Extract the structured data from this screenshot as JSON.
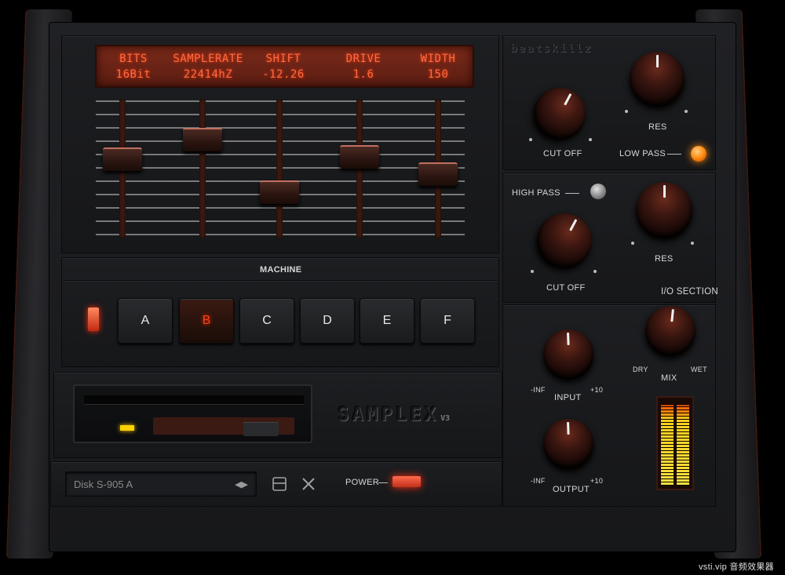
{
  "lcd": {
    "columns": [
      {
        "label": "BITS",
        "value": "16Bit"
      },
      {
        "label": "SAMPLERATE",
        "value": "22414hZ"
      },
      {
        "label": "SHIFT",
        "value": "-12.26"
      },
      {
        "label": "DRIVE",
        "value": "1.6"
      },
      {
        "label": "WIDTH",
        "value": "150"
      }
    ]
  },
  "sliders": {
    "bits": 0.58,
    "samplerate": 0.75,
    "shift": 0.3,
    "drive": 0.6,
    "width": 0.45
  },
  "brand": "beatskillz",
  "filter_lowpass": {
    "cutoff_label": "CUT OFF",
    "res_label": "RES",
    "toggle_label": "LOW PASS",
    "enabled": true
  },
  "filter_highpass": {
    "toggle_label": "HIGH PASS",
    "cutoff_label": "CUT OFF",
    "res_label": "RES",
    "enabled": false
  },
  "machine": {
    "title": "MACHINE",
    "buttons": [
      "A",
      "B",
      "C",
      "D",
      "E",
      "F"
    ],
    "selected": "B"
  },
  "product": {
    "name": "SAMPLEX",
    "version": "V3"
  },
  "disk": {
    "name": "Disk S-905 A",
    "arrows": "◀▶"
  },
  "power": {
    "label": "POWER",
    "on": true
  },
  "io": {
    "title": "I/O SECTION",
    "input_label": "INPUT",
    "input_min": "-INF",
    "input_max": "+10",
    "output_label": "OUTPUT",
    "output_min": "-INF",
    "output_max": "+10",
    "mix_label": "MIX",
    "mix_dry": "DRY",
    "mix_wet": "WET"
  },
  "meter": {
    "left": 0.95,
    "right": 0.95
  },
  "watermark": "vsti.vip 音频效果器",
  "colors": {
    "accent": "#ff4a1a",
    "lcd_text": "#ff6a40",
    "meter": "#ffd020",
    "led_on": "#ff8a10"
  }
}
